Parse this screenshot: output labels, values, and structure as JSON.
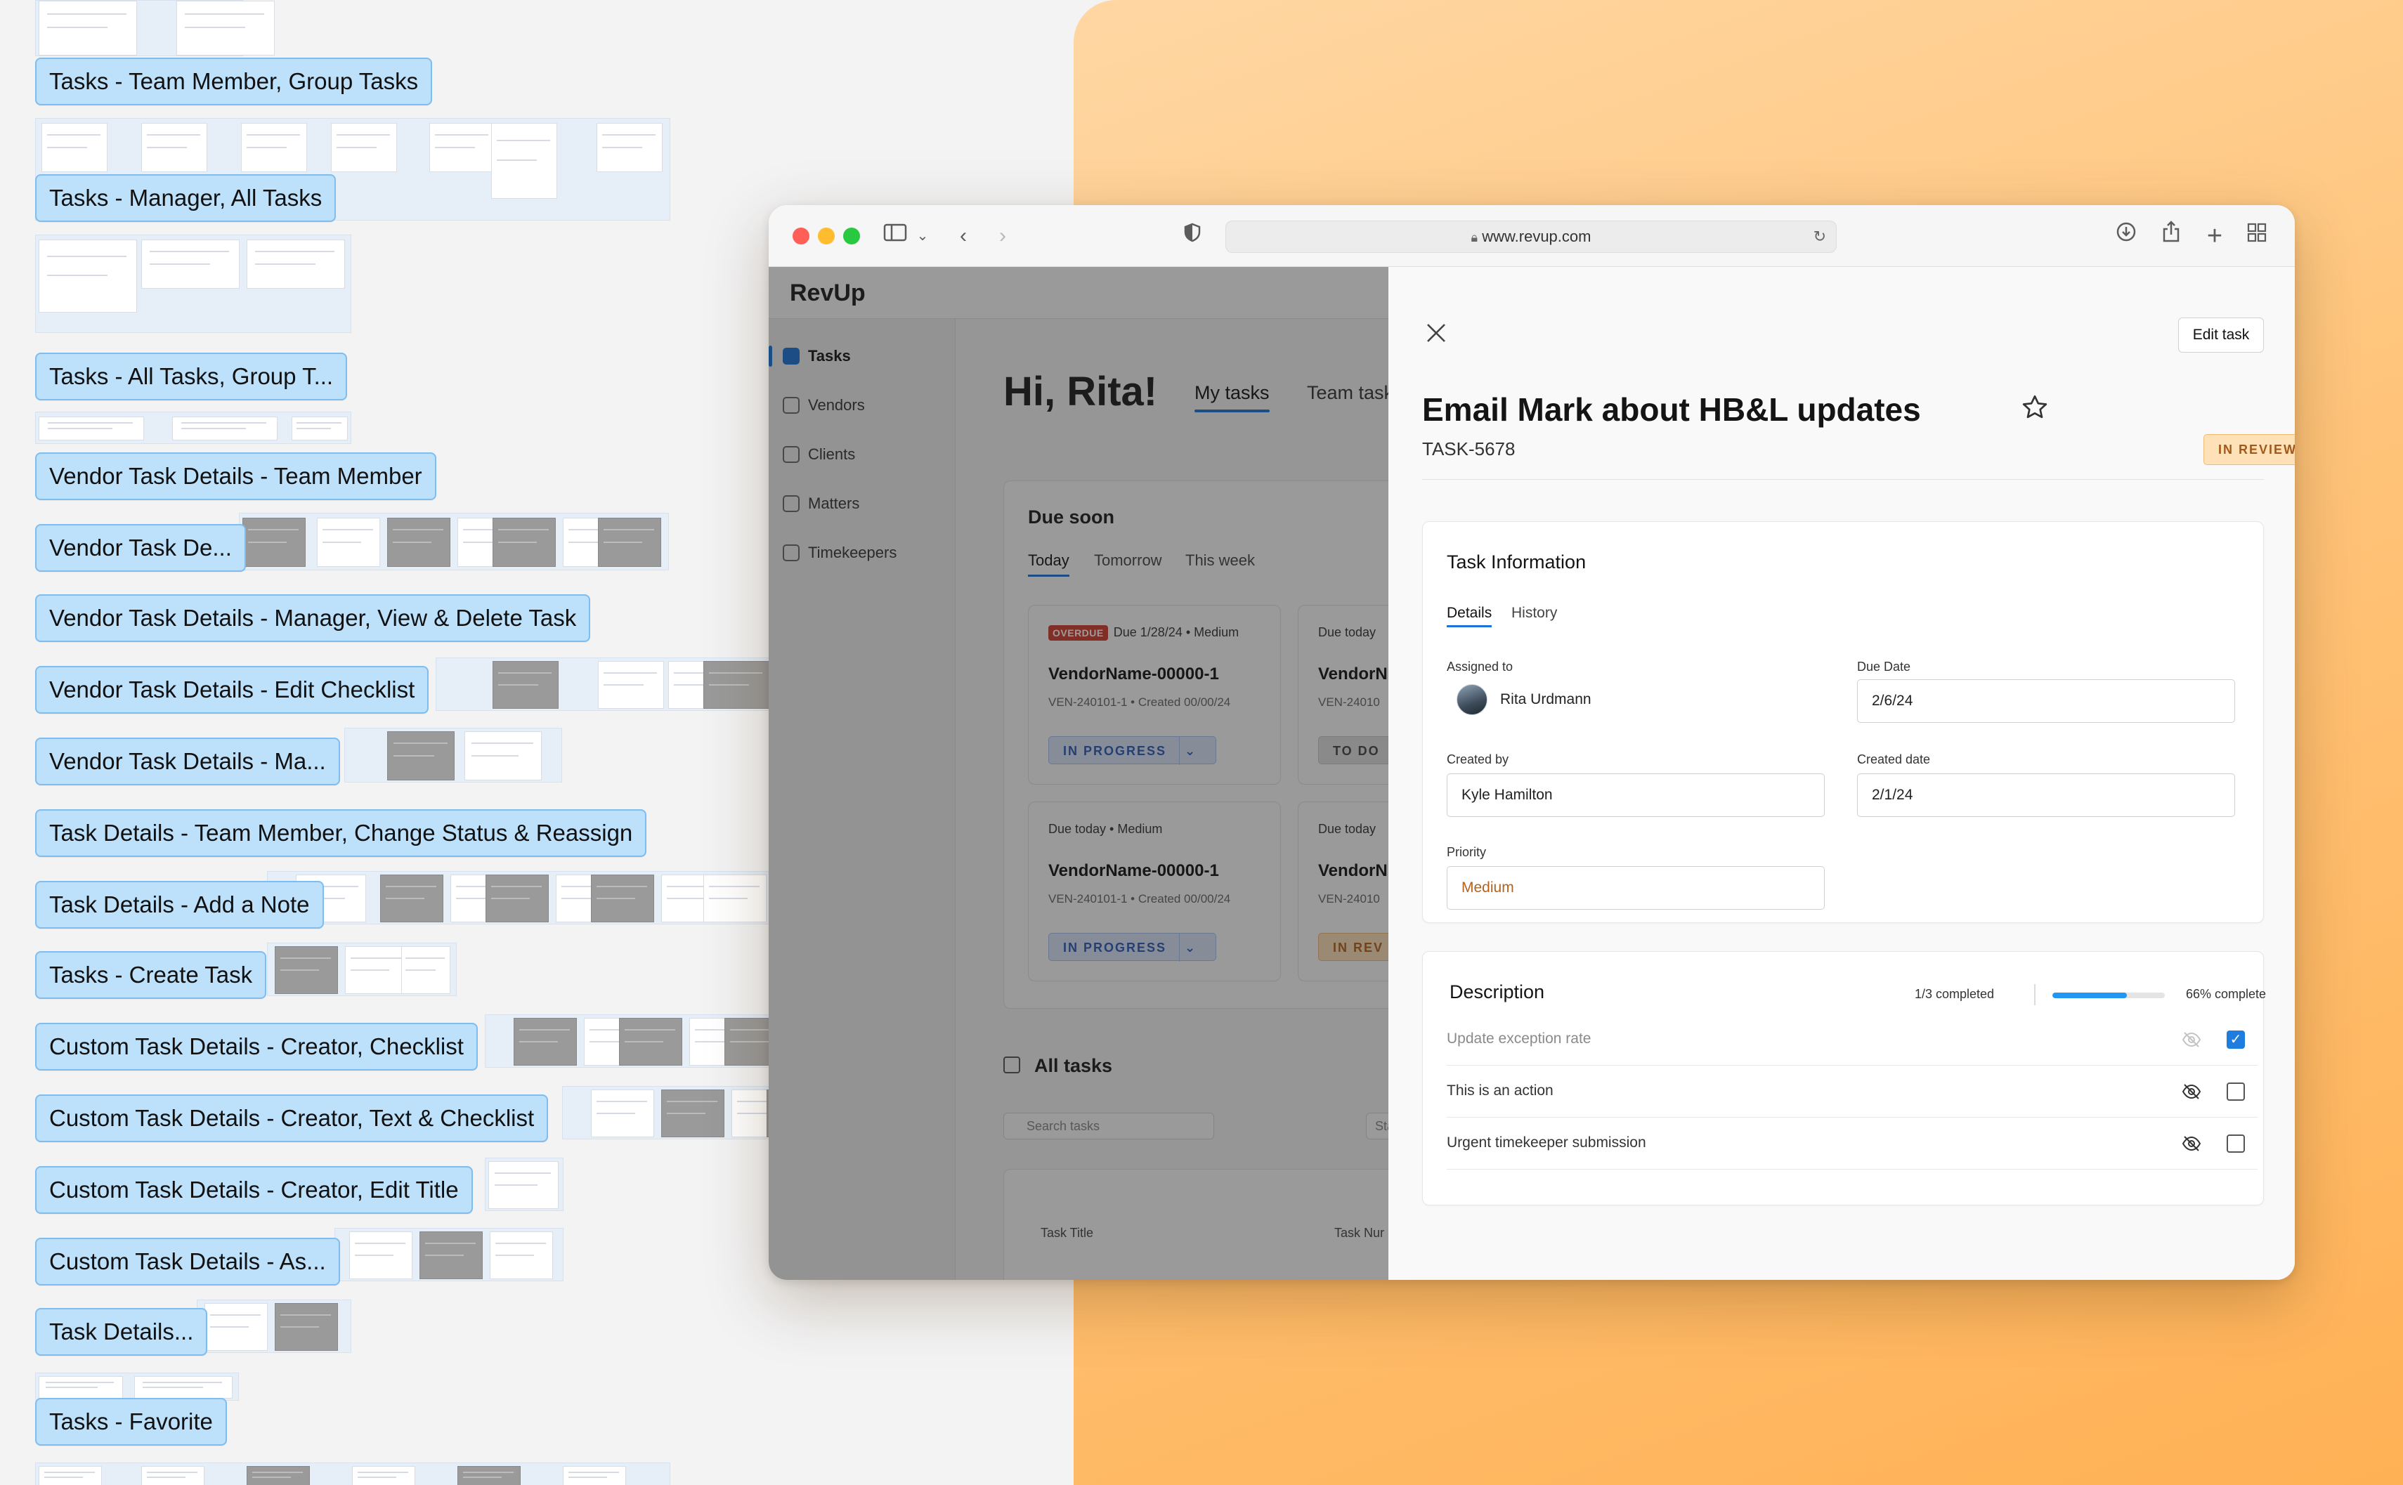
{
  "left_canvas": {
    "frames": [
      "Tasks - Team Member, Group Tasks",
      "Tasks - Manager, All Tasks",
      "Tasks - All Tasks, Group T...",
      "Vendor Task Details - Team Member",
      "Vendor Task De...",
      "Vendor Task Details - Manager, View & Delete Task",
      "Vendor Task Details - Edit Checklist",
      "Vendor Task Details - Ma...",
      "Task Details - Team Member, Change Status & Reassign",
      "Task Details - Add a Note",
      "Tasks - Create Task",
      "Custom Task Details - Creator, Checklist",
      "Custom Task Details - Creator, Text & Checklist",
      "Custom Task Details - Creator, Edit Title",
      "Custom Task Details - As...",
      "Task Details...",
      "Tasks - Favorite"
    ]
  },
  "browser": {
    "url": "www.revup.com",
    "icons": [
      "sidebar-toggle-icon",
      "back-icon",
      "forward-icon",
      "shield-icon",
      "reload-icon",
      "download-icon",
      "share-icon",
      "new-tab-icon",
      "tab-overview-icon"
    ],
    "traffic_colors": [
      "#ff5f57",
      "#febc2e",
      "#28c840"
    ]
  },
  "app": {
    "brand": "RevUp",
    "nav": [
      {
        "label": "Tasks",
        "icon": "tasks-icon",
        "active": true
      },
      {
        "label": "Vendors",
        "icon": "vendors-icon"
      },
      {
        "label": "Clients",
        "icon": "clients-icon"
      },
      {
        "label": "Matters",
        "icon": "matters-icon"
      },
      {
        "label": "Timekeepers",
        "icon": "timekeepers-icon"
      }
    ],
    "greeting": "Hi, Rita!",
    "top_tabs": [
      "My tasks",
      "Team tasks"
    ],
    "due_soon": {
      "title": "Due soon",
      "tabs": [
        "Today",
        "Tomorrow",
        "This week"
      ],
      "cards": [
        {
          "badge": "OVERDUE",
          "meta": "Due 1/28/24 • Medium",
          "name": "VendorName-00000-1",
          "sub": "VEN-240101-1 • Created 00/00/24",
          "status": "IN PROGRESS"
        },
        {
          "meta": "Due today",
          "name": "VendorN",
          "sub": "VEN-24010",
          "status": "TO DO"
        },
        {
          "meta": "Due today • Medium",
          "name": "VendorName-00000-1",
          "sub": "VEN-240101-1 • Created 00/00/24",
          "status": "IN PROGRESS"
        },
        {
          "meta": "Due today",
          "name": "VendorN",
          "sub": "VEN-24010",
          "status": "IN REV"
        }
      ]
    },
    "all_tasks": {
      "title": "All tasks",
      "search_placeholder": "Search tasks",
      "status_placeholder": "Status",
      "columns": [
        "Task Title",
        "Task Nur"
      ]
    }
  },
  "drawer": {
    "edit_label": "Edit task",
    "title": "Email Mark about HB&L updates",
    "task_id": "TASK-5678",
    "status": "IN REVIEW",
    "info": {
      "title": "Task Information",
      "tabs": [
        "Details",
        "History"
      ],
      "assigned_label": "Assigned to",
      "assigned_value": "Rita Urdmann",
      "due_label": "Due Date",
      "due_value": "2/6/24",
      "created_by_label": "Created by",
      "created_by_value": "Kyle Hamilton",
      "created_date_label": "Created date",
      "created_date_value": "2/1/24",
      "priority_label": "Priority",
      "priority_value": "Medium"
    },
    "description": {
      "title": "Description",
      "completed_text": "1/3 completed",
      "percent_text": "66% complete",
      "progress": 0.66,
      "items": [
        {
          "text": "Update exception rate",
          "checked": true
        },
        {
          "text": "This is an action",
          "checked": false
        },
        {
          "text": "Urgent timekeeper submission",
          "checked": false
        }
      ]
    }
  },
  "colors": {
    "accent": "#1a73d9",
    "status_review_bg": "#ffe1b8",
    "status_review_text": "#a35817",
    "pill_bg": "#bde0fb",
    "right_bg": "#ffc47a"
  }
}
